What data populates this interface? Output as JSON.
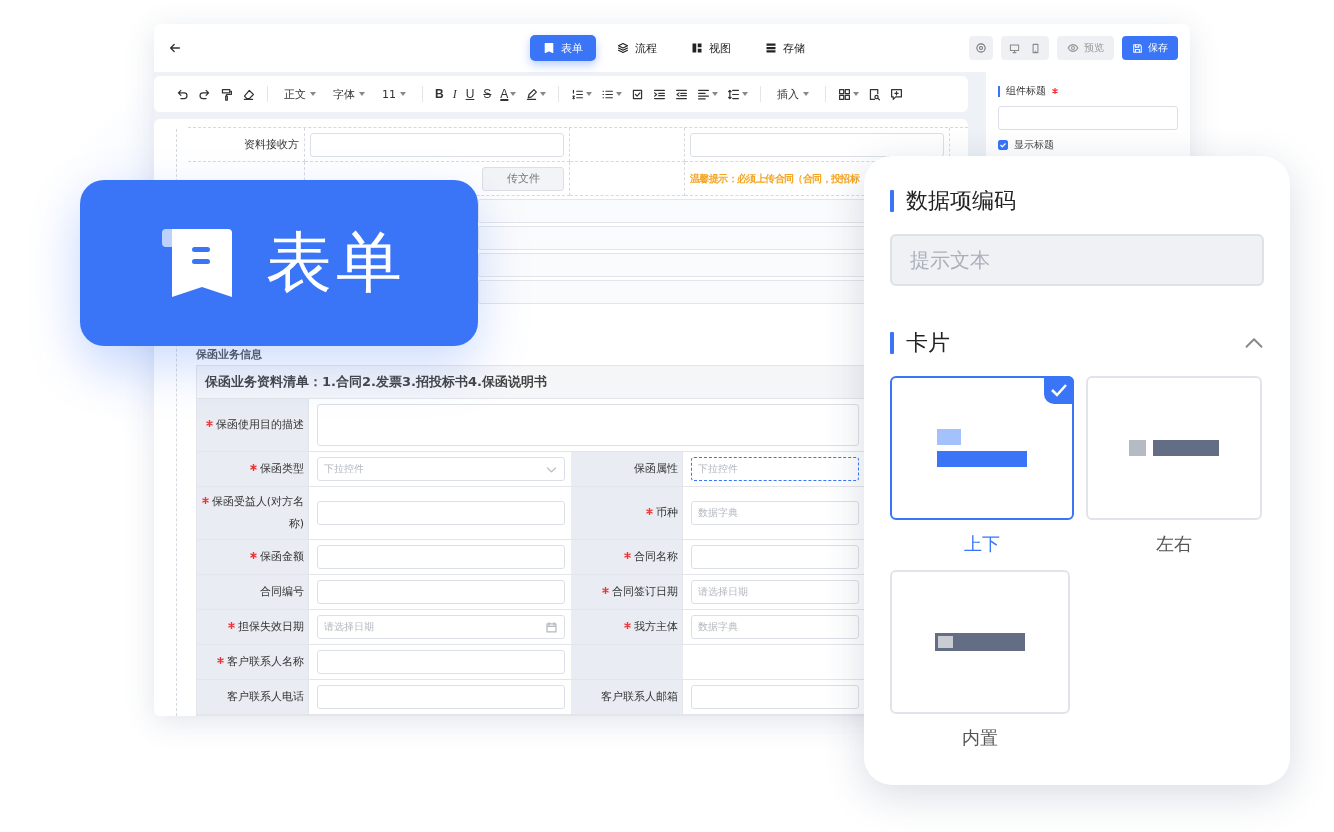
{
  "header": {
    "tabs": [
      {
        "kind": "form",
        "label": "表单",
        "selected": true
      },
      {
        "kind": "flow",
        "label": "流程",
        "selected": false
      },
      {
        "kind": "view",
        "label": "视图",
        "selected": false
      },
      {
        "kind": "storage",
        "label": "存储",
        "selected": false
      }
    ],
    "devices": [
      {
        "kind": "desktop",
        "selected": false
      },
      {
        "kind": "mobile",
        "selected": false
      }
    ],
    "preview_button": "预览",
    "save_button": "保存"
  },
  "toolbar": [
    {
      "kind": "undo"
    },
    {
      "kind": "redo"
    },
    {
      "kind": "painter"
    },
    {
      "kind": "eraser"
    },
    {
      "kind": "separator"
    },
    {
      "kind": "dropdown",
      "label": "正文"
    },
    {
      "kind": "dropdown",
      "label": "字体"
    },
    {
      "kind": "dropdown",
      "label": "11"
    },
    {
      "kind": "separator"
    },
    {
      "kind": "bold",
      "label": "B"
    },
    {
      "kind": "italic",
      "label": "I"
    },
    {
      "kind": "underline",
      "label": "U"
    },
    {
      "kind": "strike",
      "label": "S"
    },
    {
      "kind": "color",
      "label": "A"
    },
    {
      "kind": "highlight"
    },
    {
      "kind": "separator"
    },
    {
      "kind": "ordered-list"
    },
    {
      "kind": "bullet-list"
    },
    {
      "kind": "checklist"
    },
    {
      "kind": "indent"
    },
    {
      "kind": "outdent"
    },
    {
      "kind": "align"
    },
    {
      "kind": "line-height"
    },
    {
      "kind": "separator"
    },
    {
      "kind": "dropdown",
      "label": "插入"
    },
    {
      "kind": "separator"
    },
    {
      "kind": "table"
    },
    {
      "kind": "find"
    },
    {
      "kind": "comment"
    }
  ],
  "form": {
    "top_rows": [
      {
        "label": "资料接收方",
        "field": {
          "kind": "text"
        },
        "right": {
          "kind": "input"
        }
      },
      {
        "field": {
          "kind": "upload",
          "text": "传文件"
        },
        "right": {
          "kind": "hint",
          "text": "温馨提示：必须上传合同（合同，投招标"
        }
      }
    ],
    "section_title": "保函业务信息",
    "list_title": "保函业务资料清单：1.合同2.发票3.招投标书4.保函说明书",
    "rows": [
      {
        "tall": true,
        "cells": [
          {
            "label": "保函使用目的描述",
            "required": true,
            "field": {
              "kind": "textarea"
            }
          }
        ]
      },
      {
        "cells": [
          {
            "label": "保函类型",
            "required": true,
            "field": {
              "kind": "select",
              "placeholder": "下拉控件"
            }
          },
          {
            "label": "保函属性",
            "required": false,
            "field": {
              "kind": "select",
              "placeholder": "下拉控件",
              "focused": true
            }
          }
        ]
      },
      {
        "tall": true,
        "cells": [
          {
            "label": "保函受益人(对方名称)",
            "required": true,
            "field": {
              "kind": "text"
            }
          },
          {
            "label": "币种",
            "required": true,
            "field": {
              "kind": "text",
              "placeholder": "数据字典"
            }
          }
        ]
      },
      {
        "cells": [
          {
            "label": "保函金额",
            "required": true,
            "field": {
              "kind": "text"
            }
          },
          {
            "label": "合同名称",
            "required": true,
            "field": {
              "kind": "text"
            }
          }
        ]
      },
      {
        "cells": [
          {
            "label": "合同编号",
            "required": false,
            "field": {
              "kind": "text"
            }
          },
          {
            "label": "合同签订日期",
            "required": true,
            "field": {
              "kind": "text",
              "placeholder": "请选择日期"
            }
          }
        ]
      },
      {
        "cells": [
          {
            "label": "担保失效日期",
            "required": true,
            "field": {
              "kind": "date",
              "placeholder": "请选择日期"
            }
          },
          {
            "label": "我方主体",
            "required": true,
            "field": {
              "kind": "text",
              "placeholder": "数据字典"
            }
          }
        ]
      },
      {
        "cells": [
          {
            "label": "客户联系人名称",
            "required": true,
            "field": {
              "kind": "text"
            }
          },
          {
            "kind": "empty"
          }
        ]
      },
      {
        "cells": [
          {
            "label": "客户联系人电话",
            "required": false,
            "field": {
              "kind": "text"
            }
          },
          {
            "label": "客户联系人邮箱",
            "required": false,
            "field": {
              "kind": "text"
            }
          }
        ]
      }
    ]
  },
  "side_panel": {
    "title": "组件标题",
    "required": true,
    "show_title": {
      "label": "显示标题",
      "checked": true
    }
  },
  "badge": {
    "label": "表单"
  },
  "popup": {
    "title": "数据项编码",
    "placeholder": "提示文本",
    "section": "卡片",
    "expanded": true,
    "cards": [
      {
        "kind": "stacked",
        "label": "上下",
        "selected": true
      },
      {
        "kind": "side",
        "label": "左右",
        "selected": false
      },
      {
        "kind": "inline",
        "label": "内置",
        "selected": false
      }
    ]
  }
}
